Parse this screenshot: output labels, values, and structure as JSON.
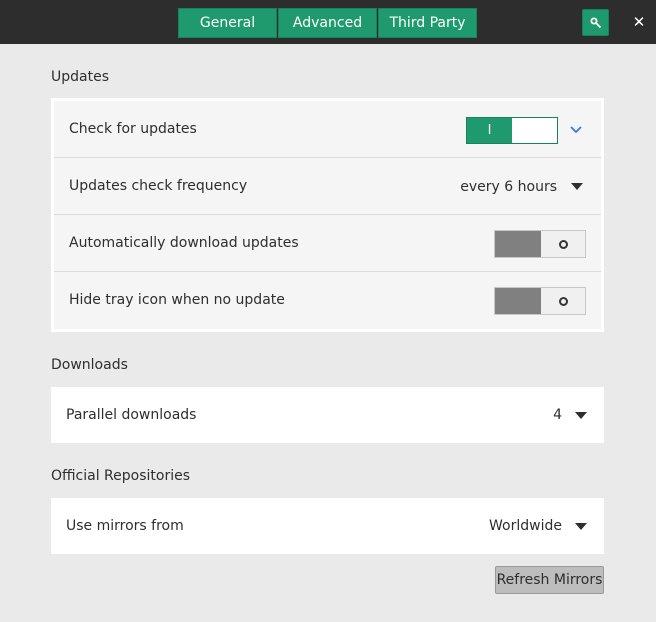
{
  "header": {
    "tabs": [
      {
        "label": "General"
      },
      {
        "label": "Advanced"
      },
      {
        "label": "Third Party"
      }
    ],
    "search_icon": "search-key-icon",
    "close_label": "✕"
  },
  "updates": {
    "title": "Updates",
    "check_for_updates": {
      "label": "Check for updates",
      "on_text": "I",
      "state": true
    },
    "frequency": {
      "label": "Updates check frequency",
      "value": "every 6 hours"
    },
    "auto_download": {
      "label": "Automatically download updates",
      "state": false
    },
    "hide_tray": {
      "label": "Hide tray icon when no update",
      "state": false
    }
  },
  "downloads": {
    "title": "Downloads",
    "parallel": {
      "label": "Parallel downloads",
      "value": "4"
    }
  },
  "official_repos": {
    "title": "Official Repositories",
    "mirrors": {
      "label": "Use mirrors from",
      "value": "Worldwide"
    },
    "refresh_label": "Refresh Mirrors"
  },
  "colors": {
    "accent": "#1f9a6e",
    "headerbar": "#2d2d2d",
    "background": "#eaeaea",
    "chevron": "#3a7bd5"
  }
}
